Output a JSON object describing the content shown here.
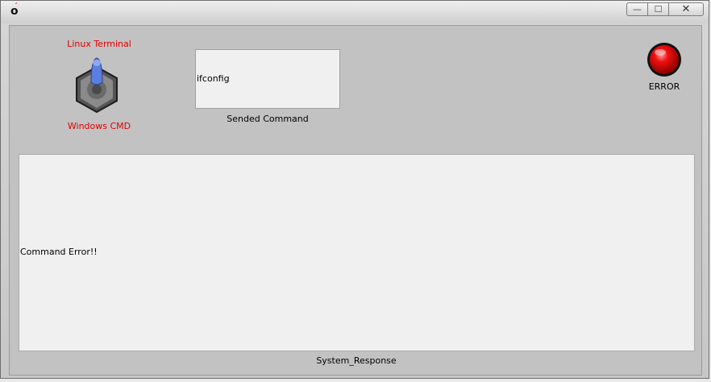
{
  "window": {
    "controls": {
      "minimize": "—",
      "maximize": "☐",
      "close": "✕"
    }
  },
  "toggle": {
    "top_label": "Linux Terminal",
    "bottom_label": "Windows CMD",
    "selected": "Linux Terminal"
  },
  "command": {
    "value": "ifconfig",
    "caption": "Sended Command"
  },
  "status": {
    "label": "ERROR",
    "color": "#e00000"
  },
  "response": {
    "text": "Command Error!!",
    "caption": "System_Response"
  },
  "icons": [
    "app-icon",
    "toggle-switch-icon",
    "status-led-icon"
  ]
}
